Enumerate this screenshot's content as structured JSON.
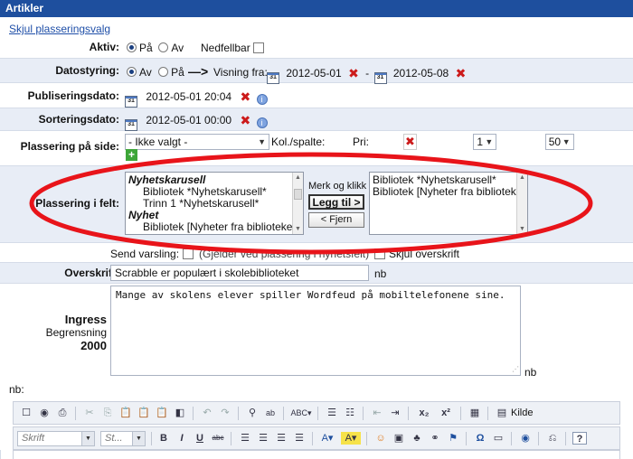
{
  "window": {
    "title": "Artikler"
  },
  "hide_link": "Skjul plasseringsvalg",
  "aktiv": {
    "label": "Aktiv:",
    "on": "På",
    "off": "Av",
    "nedfellbar": "Nedfellbar"
  },
  "datostyring": {
    "label": "Datostyring:",
    "off": "Av",
    "on": "På",
    "arrow": "—>",
    "visning_label": "Visning fra:",
    "from": "2012-05-01",
    "dash": "-",
    "to": "2012-05-08"
  },
  "publisering": {
    "label": "Publiseringsdato:",
    "value": "2012-05-01 20:04"
  },
  "sortering": {
    "label": "Sorteringsdato:",
    "value": "2012-05-01 00:00"
  },
  "plassering_side": {
    "label": "Plassering på side:",
    "select": "- Ikke valgt -",
    "kol_label": "Kol./spalte:",
    "kol": "1",
    "pri_label": "Pri:",
    "pri": "50"
  },
  "plassering_felt": {
    "label": "Plassering i felt:",
    "available": [
      {
        "text": "Nyhetskarusell",
        "type": "group"
      },
      {
        "text": "Bibliotek *Nyhetskarusell*",
        "type": "item"
      },
      {
        "text": "Trinn 1 *Nyhetskarusell*",
        "type": "item"
      },
      {
        "text": "Nyhet",
        "type": "group"
      },
      {
        "text": "Bibliotek [Nyheter fra biblioteket",
        "type": "item"
      }
    ],
    "hint": "Merk og klikk",
    "add": "Legg til >",
    "remove": "< Fjern",
    "selected": [
      "Bibliotek *Nyhetskarusell*",
      "Bibliotek [Nyheter fra bibliotek"
    ]
  },
  "send_varsling": {
    "label": "Send varsling:",
    "note": "(Gjelder ved plassering i nyhetsfelt)",
    "skjul": "Skjul overskrift"
  },
  "overskrift": {
    "label": "Overskrift:",
    "value": "Scrabble er populært i skolebiblioteket",
    "lang": "nb"
  },
  "ingress": {
    "label": "Ingress",
    "limit_label": "Begrensning",
    "limit": "2000",
    "value": "Mange av skolens elever spiller Wordfeud på mobiltelefonene sine.",
    "lang": "nb"
  },
  "body_lang": "nb:",
  "toolbar": {
    "format_placeholder": "Skrift",
    "style_placeholder": "St...",
    "source": "Kilde"
  },
  "colors": {
    "title_bar": "#1e4f9e",
    "annotation": "#e8141a"
  }
}
